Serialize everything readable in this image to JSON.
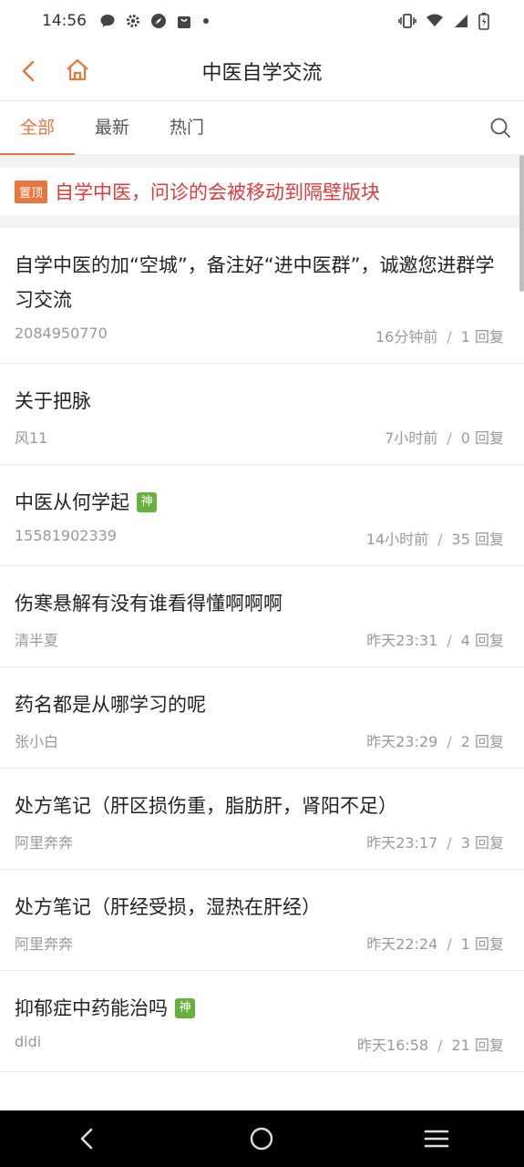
{
  "status_bar": {
    "time": "14:56",
    "left_icons": [
      "message-icon",
      "settings-icon",
      "compass-icon",
      "bag-icon",
      "dot-icon"
    ],
    "right_icons": [
      "vibrate-icon",
      "wifi-icon",
      "signal-icon",
      "battery-icon"
    ]
  },
  "header": {
    "title": "中医自学交流"
  },
  "tabs": [
    {
      "label": "全部",
      "active": true
    },
    {
      "label": "最新",
      "active": false
    },
    {
      "label": "热门",
      "active": false
    }
  ],
  "pinned": {
    "badge": "置顶",
    "text": "自学中医，问诊的会被移动到隔壁版块"
  },
  "posts": [
    {
      "title": "自学中医的加“空城”，备注好“进中医群”，诚邀您进群学习交流",
      "author": "2084950770",
      "time": "16分钟前",
      "replies": "1 回复",
      "badge": ""
    },
    {
      "title": "关于把脉",
      "author": "风11",
      "time": "7小时前",
      "replies": "0 回复",
      "badge": ""
    },
    {
      "title": "中医从何学起",
      "author": "15581902339",
      "time": "14小时前",
      "replies": "35 回复",
      "badge": "神"
    },
    {
      "title": "伤寒悬解有没有谁看得懂啊啊啊",
      "author": "清半夏",
      "time": "昨天23:31",
      "replies": "4 回复",
      "badge": ""
    },
    {
      "title": "药名都是从哪学习的呢",
      "author": "张小白",
      "time": "昨天23:29",
      "replies": "2 回复",
      "badge": ""
    },
    {
      "title": "处方笔记（肝区损伤重，脂肪肝，肾阳不足）",
      "author": "阿里奔奔",
      "time": "昨天23:17",
      "replies": "3 回复",
      "badge": ""
    },
    {
      "title": "处方笔记（肝经受损，湿热在肝经）",
      "author": "阿里奔奔",
      "time": "昨天22:24",
      "replies": "1 回复",
      "badge": ""
    },
    {
      "title": "抑郁症中药能治吗",
      "author": "didi",
      "time": "昨天16:58",
      "replies": "21 回复",
      "badge": "神"
    }
  ],
  "meta_separator": "/",
  "colors": {
    "accent": "#e8763f",
    "pinned_text": "#e33b3b",
    "badge_green": "#67b13f"
  }
}
